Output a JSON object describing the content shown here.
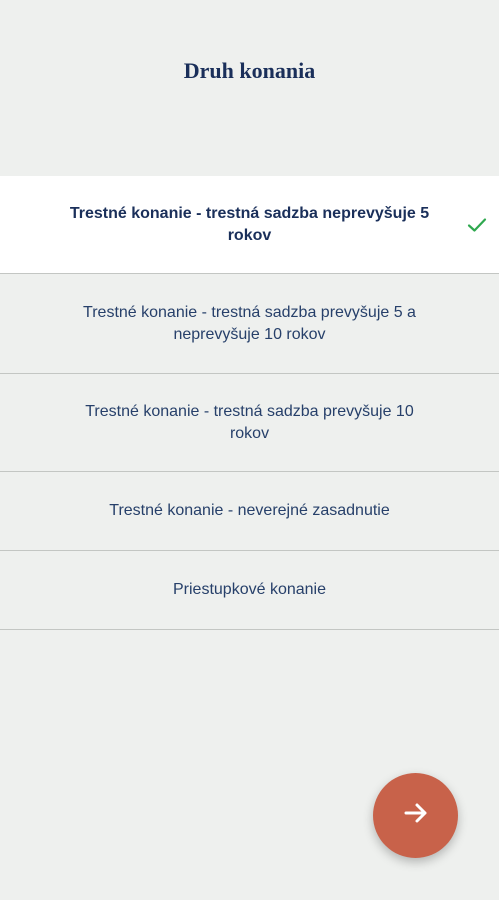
{
  "header": {
    "title": "Druh konania"
  },
  "options": [
    {
      "label": "Trestné konanie - trestná sadzba neprevyšuje 5 rokov",
      "selected": true
    },
    {
      "label": "Trestné konanie - trestná sadzba prevyšuje 5 a neprevyšuje 10 rokov",
      "selected": false
    },
    {
      "label": "Trestné konanie - trestná sadzba prevyšuje 10 rokov",
      "selected": false
    },
    {
      "label": "Trestné konanie - neverejné zasadnutie",
      "selected": false
    },
    {
      "label": "Priestupkové konanie",
      "selected": false
    }
  ],
  "icons": {
    "selected": "checkmark-icon",
    "next": "arrow-right-icon"
  },
  "colors": {
    "background": "#eef0ee",
    "selected_background": "#ffffff",
    "title": "#1a2f5a",
    "text": "#27406a",
    "check": "#2fa84f",
    "fab": "#c8624a"
  }
}
